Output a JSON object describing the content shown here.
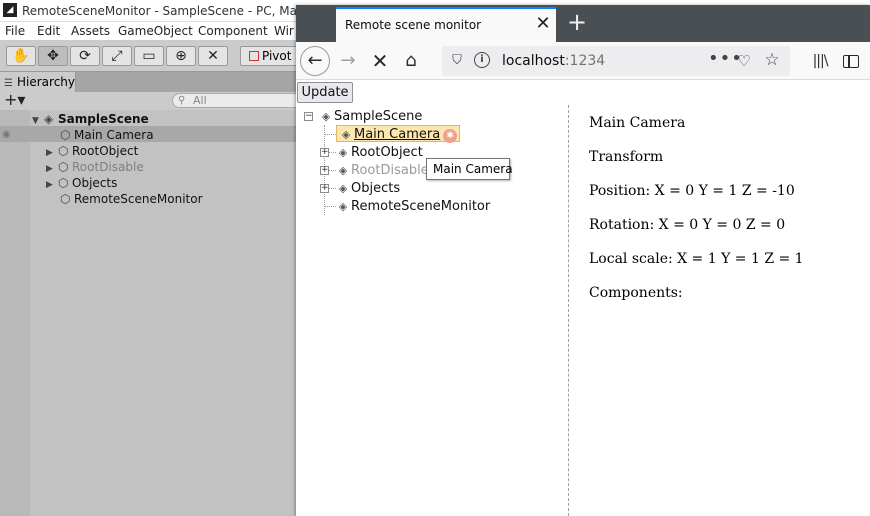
{
  "unity": {
    "title": "RemoteSceneMonitor - SampleScene - PC, Mac & Li",
    "logo": "◢",
    "menu": [
      "File",
      "Edit",
      "Assets",
      "GameObject",
      "Component",
      "Wir"
    ],
    "toolbar": {
      "tools": [
        "✋",
        "✥",
        "⟳",
        "⤢",
        "▭",
        "⊕",
        "✕"
      ],
      "pivot_label": "Pivot"
    },
    "hierarchy": {
      "tab_label": "Hierarchy",
      "add_label": "+▾",
      "search_placeholder": "All",
      "rows": [
        {
          "label": "SampleScene",
          "kind": "scene"
        },
        {
          "label": "Main Camera",
          "kind": "object"
        },
        {
          "label": "RootObject",
          "kind": "object"
        },
        {
          "label": "RootDisable",
          "kind": "disabled"
        },
        {
          "label": "Objects",
          "kind": "object"
        },
        {
          "label": "RemoteSceneMonitor",
          "kind": "object"
        }
      ]
    }
  },
  "browser": {
    "tab_title": "Remote scene monitor",
    "tab_close": "✕",
    "new_tab": "+",
    "nav": {
      "back": "←",
      "forward": "→",
      "stop": "✕",
      "home": "⌂",
      "library": "|||\\",
      "more": "•••",
      "pocket": "♡",
      "star": "☆",
      "shield": "⛉",
      "info": "i"
    },
    "url": {
      "host": "localhost",
      "port": ":1234"
    },
    "update_label": "Update",
    "tree": {
      "root": "SampleScene",
      "children": [
        {
          "label": "Main Camera",
          "selected": true,
          "expandable": false
        },
        {
          "label": "RootObject",
          "expandable": true
        },
        {
          "label": "RootDisable",
          "disabled": true,
          "expandable": true
        },
        {
          "label": "Objects",
          "expandable": true
        },
        {
          "label": "RemoteSceneMonitor",
          "expandable": false
        }
      ],
      "tooltip": "Main Camera"
    },
    "details": {
      "name": "Main Camera",
      "section": "Transform",
      "position": "Position: X = 0 Y = 1 Z = -10",
      "rotation": "Rotation: X = 0 Y = 0 Z = 0",
      "scale": "Local scale: X = 1 Y = 1 Z = 1",
      "components": "Components:"
    }
  }
}
